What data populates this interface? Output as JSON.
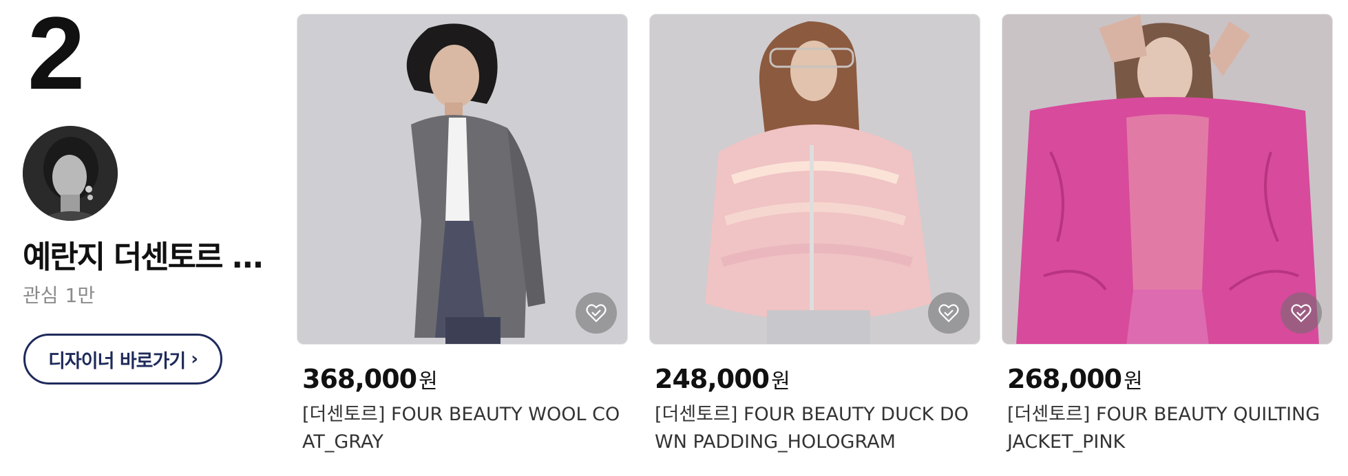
{
  "rank": "2",
  "designer": {
    "name": "예란지 더센토르 ...",
    "interest_label": "관심",
    "interest_count": "1만",
    "button_label": "디자이너 바로가기",
    "button_chevron": "›"
  },
  "products": [
    {
      "price": "368,000",
      "currency": "원",
      "title": "[더센토르] FOUR BEAUTY WOOL COAT_GRAY",
      "image": "model-gray-wool-coat",
      "wish_icon": "heart-check-icon"
    },
    {
      "price": "248,000",
      "currency": "원",
      "title": "[더센토르] FOUR BEAUTY DUCK DOWN PADDING_HOLOGRAM",
      "image": "model-hologram-puffer",
      "wish_icon": "heart-check-icon"
    },
    {
      "price": "268,000",
      "currency": "원",
      "title": "[더센토르] FOUR BEAUTY QUILTING JACKET_PINK",
      "image": "model-pink-quilted-jacket",
      "wish_icon": "heart-check-icon"
    }
  ],
  "colors": {
    "button_border": "#1e2a5a",
    "muted_text": "#8a8a8a"
  }
}
